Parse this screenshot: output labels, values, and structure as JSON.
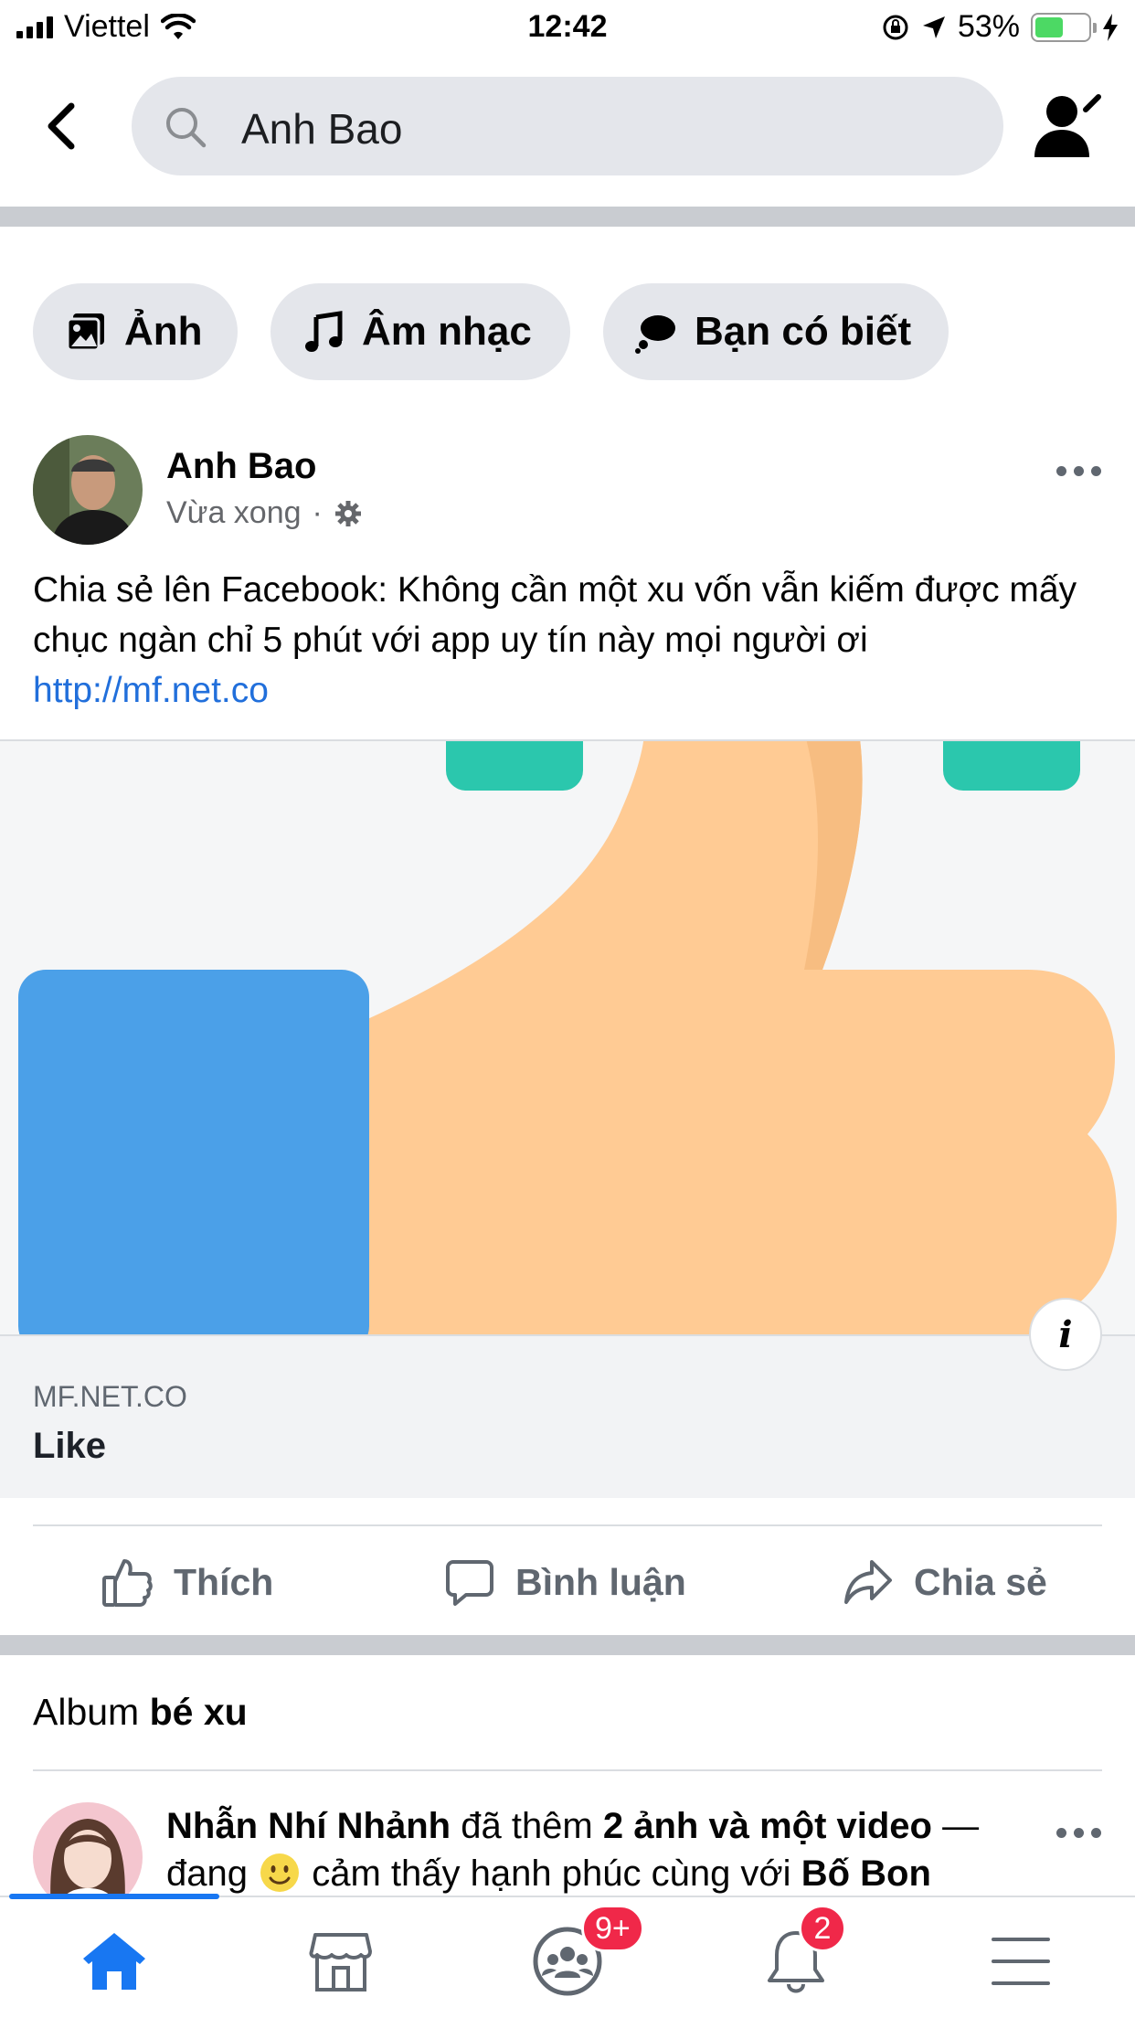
{
  "status_bar": {
    "carrier": "Viettel",
    "time": "12:42",
    "battery_percent": "53%",
    "battery_level": 0.53
  },
  "search": {
    "query": "Anh Bao"
  },
  "filters": [
    {
      "label": "Ảnh",
      "icon": "photo-icon"
    },
    {
      "label": "Âm nhạc",
      "icon": "music-note-icon"
    },
    {
      "label": "Bạn có biết",
      "icon": "thought-bubble-icon"
    }
  ],
  "post": {
    "author": "Anh Bao",
    "time": "Vừa xong",
    "privacy_icon": "gear-icon",
    "text": "Chia sẻ lên Facebook: Không cần một xu vốn vẫn kiếm được mấy chục ngàn chỉ 5 phút với app uy tín này mọi người ơi",
    "link": "http://mf.net.co",
    "preview": {
      "domain": "MF.NET.CO",
      "title": "Like",
      "info_glyph": "i"
    }
  },
  "actions": {
    "like": "Thích",
    "comment": "Bình luận",
    "share": "Chia sẻ"
  },
  "album": {
    "prefix": "Album",
    "name": "bé xu"
  },
  "post2": {
    "author": "Nhẫn Nhí Nhảnh",
    "verb": "đã thêm",
    "object": "2 ảnh và một video",
    "dash": "—",
    "line2_pre": "đang",
    "feeling": "cảm thấy hạnh phúc cùng với",
    "tagged": "Bố Bon"
  },
  "tab_bar": {
    "active": "home",
    "groups_badge": "9+",
    "notifications_badge": "2"
  },
  "colors": {
    "accent": "#1877f2",
    "badge": "#f02849",
    "link": "#216fdb"
  }
}
